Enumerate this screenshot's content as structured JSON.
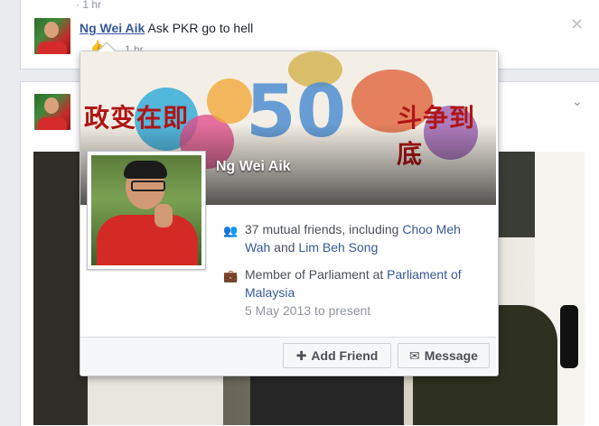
{
  "feed": {
    "story1": {
      "top_meta": "· 1 hr",
      "author": "Ng Wei Aik",
      "text": "Ask PKR go to hell",
      "time": "1 hr",
      "close": "✕"
    },
    "story2": {
      "chevron": "⌄"
    }
  },
  "hovercard": {
    "name": "Ng Wei Aik",
    "cover": {
      "left_text": "政变在即",
      "right_text": "斗争到底",
      "badge": "50"
    },
    "mutual": {
      "prefix": "37 mutual friends, including ",
      "friend1": "Choo Meh",
      "friend1b": "Wah",
      "and": " and ",
      "friend2": "Lim Beh Song"
    },
    "work": {
      "prefix": "Member of Parliament at ",
      "org1": "Parliament of",
      "org2": "Malaysia",
      "dates": "5 May 2013 to present"
    },
    "buttons": {
      "add_friend": "Add Friend",
      "message": "Message"
    }
  },
  "icons": {
    "mutual": "friends-icon",
    "work": "briefcase-icon",
    "add_friend": "add-friend-icon",
    "message": "message-icon"
  }
}
